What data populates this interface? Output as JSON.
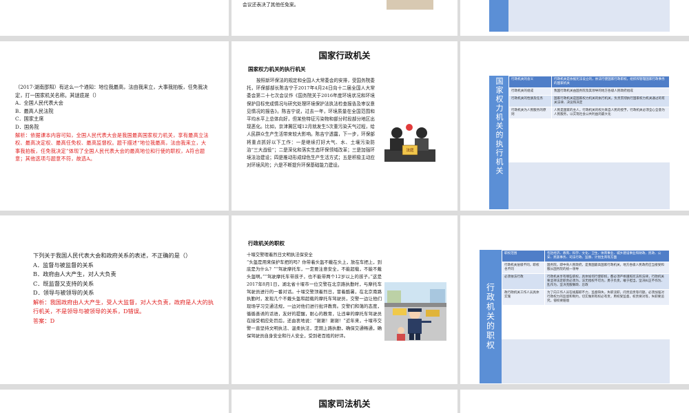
{
  "slides": {
    "top_mid_text": "会议还表决了其他任免案。",
    "quiz1": {
      "stem": "（2017·湖南邵阳）有这么一个通知：地位我最高，法由我来立，大事我拍板，任免我决定，打一国家机关名称。其谜底是（）",
      "options": [
        "A．全国人民代表大会",
        "B．最高人民法院",
        "C．国家主席",
        "D．国务院"
      ],
      "analysis": "解析：依据课本内容可知，全国人民代表大会是我国最高国家权力机关，享有最高立法权、最高决定权、最高任免权、最高监督权。题干描述“地位我最高，法由我来立，大事我拍板，任免我决定”体现了全国人民代表大会的最高地位和行使的职权，A符合题意；其他选项与题意不符，故选A。"
    },
    "admin": {
      "title": "国家行政机关",
      "subtitle": "国家权力机关的执行机关",
      "paragraph": "按照新环保法的规定和全国人大常委会的安排，受国务院委托，环保部部长陈吉宁于2017年4月24日向十二届全国人大常委会第二十七次会议作《国务院关于2016年度环境状况和环境保护目标完成情况与研究处理环境保护法执法检查报告及审议意见情况的报告》。陈吉宁说，过去一年，环境质量在全国范围和平均水平上总体向好，但某些特征污染物和部分时段部分地区出现恶化。比如，京津冀区域12月就发生5次重污染天气过程，给人民群众生产生活带来较大影响。陈吉宁透露，下一步，环保部将重点抓好以下工作：一是继续打好大气、水、土壤污染防治“三大战役”；二是深化和落实生态环保领域改革；三是加强环境法治建设；四是推动形成绿色生产生活方式；五是积极主动应对环境风险；六是不断提升环保基础能力建设。",
      "image_sign": "法庭"
    },
    "table1": {
      "side_label": "国家权力机关的执行机关",
      "rows": [
        [
          "行政机关的含义",
          "行政机关是依据宪法设立的，依法行使国家行政职权，组织和管理国家行政事务的国家机关"
        ],
        [
          "行政机关的组成",
          "我国行政机关由国务院及其领导的地方各级人民政府组成"
        ],
        [
          "行政机关的性质及任务",
          "国家行政机关是国家权力机关的执行机关，负责贯彻执行国家权力机关通过的有关法律、决议和决定"
        ],
        [
          "行政机关为人民服务的原则",
          "人民是国家的主人，行政机关的权力来自人民的授予，行政机关必须全心全意为人民服务，以实现社会公共利益的最大化"
        ]
      ]
    },
    "quiz2": {
      "stem": "下列关于我国人民代表大会和政府关系的表述，不正确的是（）",
      "options": [
        "A．监督与被监督的关系",
        "B．政府由人大产生，对人大负责",
        "C．既监督又支持的关系",
        "D．领导与被领导的关系"
      ],
      "analysis": "解析：我国政府由人大产生，受人大监督，对人大负责，政府是人大的执行机关，不是领导与被领导的关系，D错误。",
      "answer": "答案：D"
    },
    "duty": {
      "subtitle": "行政机关的职权",
      "paragraph": "十堰交警理着烈日文明执法保安全\n“头盔是用来保护车把的吗？你带着头盔不戴在头上，放在车把上，到底是为什么？”“驾驶摩托车，一定要注意安全，不能超载，不能不戴头盔啊。”“驾驶摩托车带孩子，也不能带两个12岁以上的孩子。”这是2017年8月1日，湖北省十堰市一位交警在北京路执勤时，与摩托车驾驶员进行的一番对话。十堰交警顶着烈日，冒着酷暑，在北京南路执勤时，发现几个不戴头盔和超载的摩托车驾驶员，交警一边让他们现场学习交通法规，一边对他们进行批评教育。交警们和蔼的态度，循循善诱的话语，友好的提醒，耐心的教育，让违章的摩托车驾驶员在接受相应处罚后，还由衷地说：“谢谢！谢谢！”近年来，十堰市交警一直坚持文明执法、温柔执法，定期上路执勤，确保交通畅通，确保驾驶员自身安全和行人安全，受到老百姓的好评。"
    },
    "table2": {
      "side_label": "行政机关的职权",
      "rows": [
        [
          "职权范围",
          "包括经济、教育、科学、文化、卫生、体育事业、城乡建设事业和财政、民政、公安、民族事务、司法行政、监察、计划生育等方面"
        ],
        [
          "行政机关层级不同，职权也不同",
          "国务院，即中央人民政府，是我国最高国家行政机关，地方各级人民政府应当接受和服从国务院的统一领导"
        ],
        [
          "必须依法行政",
          "行政机关享有哪些职权，具体如何行使职权，都必须严格遵照宪法和法律，行政机关要坚持法定职责必须为，法无授权不可为，勇于负责，敢于担当，坚决纠正不作为、乱作为，坚决克服懒政、怠政"
        ],
        [
          "政行政机关工作人员具体实施",
          "为了向工作人员在规履职不力，监督缺失，失职渎职，问责追责等问题，必须加强对行政权力的监督和制约，切实做到有权必有责，用权受监督，权责要对等，失职要追究，侵权要赔偿"
        ]
      ]
    },
    "judicial": {
      "title": "国家司法机关"
    }
  }
}
